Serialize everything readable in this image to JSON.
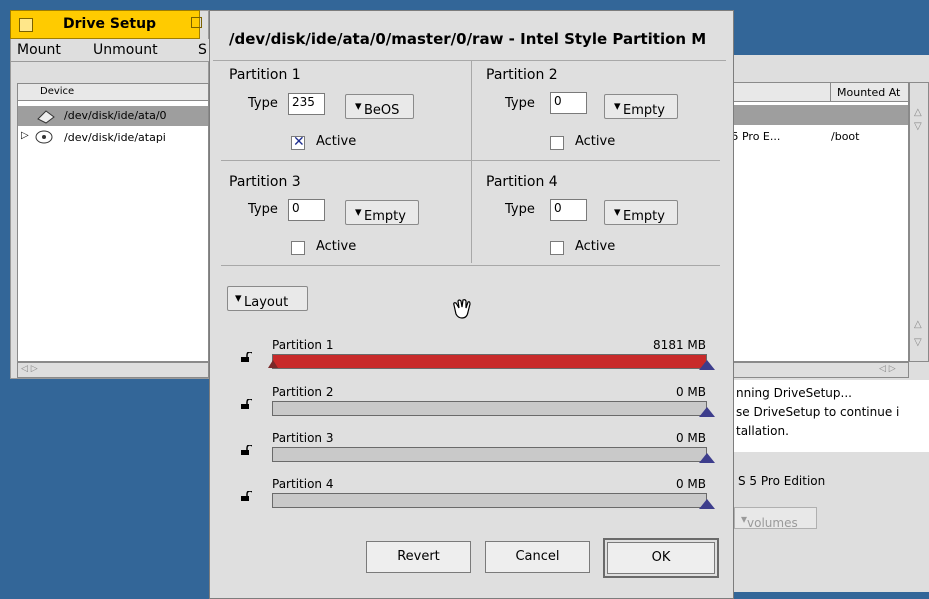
{
  "background_window": {
    "title": "Drive Setup",
    "menu": [
      "Mount",
      "Unmount",
      "S"
    ],
    "columns": {
      "device": "Device",
      "mounted_at": "Mounted At"
    },
    "rows": [
      {
        "device": "/dev/disk/ide/ata/0",
        "volume": "",
        "mounted": ""
      },
      {
        "device": "/dev/disk/ide/atapi",
        "volume": "S 5 Pro E...",
        "mounted": "/boot"
      }
    ],
    "status_lines": [
      "nning DriveSetup...",
      "se DriveSetup to continue i",
      "tallation."
    ],
    "edition": "S 5 Pro Edition",
    "volumes_button": "volumes"
  },
  "dialog": {
    "title": "/dev/disk/ide/ata/0/master/0/raw - Intel Style Partition M",
    "partitions": [
      {
        "title": "Partition 1",
        "type_label": "Type",
        "type_value": "235",
        "menu": "BeOS",
        "active_label": "Active",
        "active": true
      },
      {
        "title": "Partition 2",
        "type_label": "Type",
        "type_value": "0",
        "menu": "Empty",
        "active_label": "Active",
        "active": false
      },
      {
        "title": "Partition 3",
        "type_label": "Type",
        "type_value": "0",
        "menu": "Empty",
        "active_label": "Active",
        "active": false
      },
      {
        "title": "Partition 4",
        "type_label": "Type",
        "type_value": "0",
        "menu": "Empty",
        "active_label": "Active",
        "active": false
      }
    ],
    "layout_menu": "Layout",
    "sliders": [
      {
        "label": "Partition 1",
        "size": "8181 MB",
        "fraction": 1.0
      },
      {
        "label": "Partition 2",
        "size": "0 MB",
        "fraction": 0.0
      },
      {
        "label": "Partition 3",
        "size": "0 MB",
        "fraction": 0.0
      },
      {
        "label": "Partition 4",
        "size": "0 MB",
        "fraction": 0.0
      }
    ],
    "buttons": {
      "revert": "Revert",
      "cancel": "Cancel",
      "ok": "OK"
    }
  },
  "colors": {
    "desktop": "#336698",
    "tab": "#ffcb00",
    "partition_fill": "#c82a2a",
    "slider_thumb": "#3d3d8c"
  },
  "icons": [
    "disk-icon",
    "cdrom-icon",
    "lock-icon",
    "hand-cursor-icon"
  ]
}
